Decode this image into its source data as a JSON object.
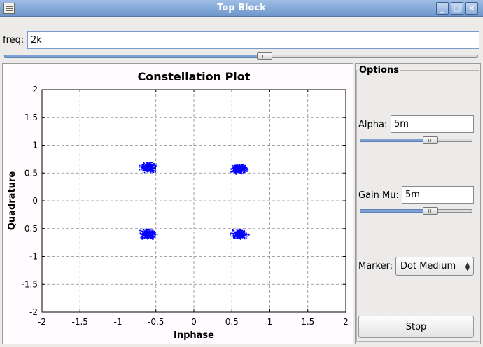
{
  "window": {
    "title": "Top Block",
    "minimize_glyph": "_",
    "maximize_glyph": "□",
    "close_glyph": "×"
  },
  "freq": {
    "label": "freq:",
    "value": "2k",
    "slider_fraction": 0.55
  },
  "options": {
    "title": "Options",
    "alpha": {
      "label": "Alpha:",
      "value": "5m",
      "slider_fraction": 0.63
    },
    "gain_mu": {
      "label": "Gain Mu:",
      "value": "5m",
      "slider_fraction": 0.63
    },
    "marker": {
      "label": "Marker:",
      "selected": "Dot Medium"
    },
    "stop_label": "Stop"
  },
  "colors": {
    "points": "#0000ff",
    "plot_background": "#fffbff",
    "grid": "#8a8a8a"
  },
  "chart_data": {
    "type": "scatter",
    "title": "Constellation Plot",
    "xlabel": "Inphase",
    "ylabel": "Quadrature",
    "xlim": [
      -2,
      2
    ],
    "ylim": [
      -2,
      2
    ],
    "xticks": [
      "-2",
      "-1.5",
      "-1",
      "-0.5",
      "0",
      "0.5",
      "1",
      "1.5",
      "2"
    ],
    "yticks": [
      "-2",
      "-1.5",
      "-1",
      "-0.5",
      "0",
      "0.5",
      "1",
      "1.5",
      "2"
    ],
    "grid": true,
    "clusters": [
      {
        "center": [
          -0.6,
          0.6
        ],
        "spread": [
          0.14,
          0.09
        ]
      },
      {
        "center": [
          0.6,
          0.57
        ],
        "spread": [
          0.14,
          0.09
        ]
      },
      {
        "center": [
          -0.6,
          -0.6
        ],
        "spread": [
          0.14,
          0.09
        ]
      },
      {
        "center": [
          0.6,
          -0.6
        ],
        "spread": [
          0.14,
          0.09
        ]
      }
    ],
    "points_per_cluster": 320
  }
}
